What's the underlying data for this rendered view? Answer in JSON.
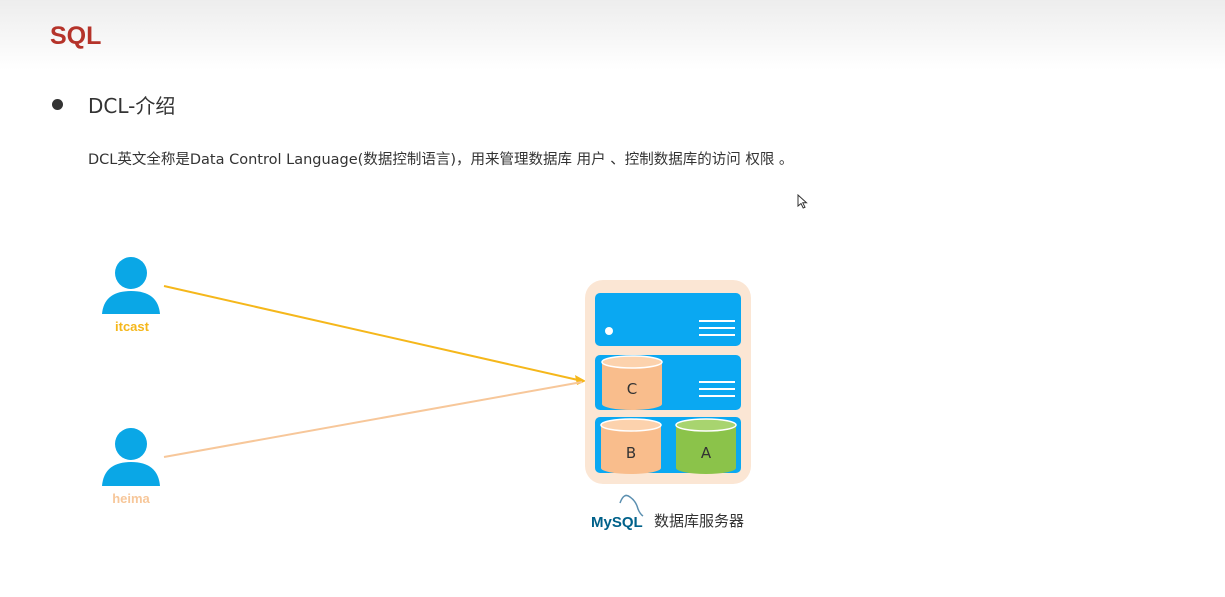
{
  "header": {
    "title": "SQL"
  },
  "content": {
    "bullet_heading": "DCL-介绍",
    "description": "DCL英文全称是Data Control Language(数据控制语言)，用来管理数据库 用户 、控制数据库的访问 权限 。"
  },
  "diagram": {
    "users": [
      {
        "name": "itcast",
        "color": "#f5b71b"
      },
      {
        "name": "heima",
        "color": "#f7c79a"
      }
    ],
    "server": {
      "databases": [
        "C",
        "B",
        "A"
      ],
      "caption": "数据库服务器",
      "logo_text": "MySQL"
    },
    "colors": {
      "user_icon": "#0aa7e6",
      "rack_background": "#fbe6d4",
      "rack_unit": "#0aa8f2",
      "cylinder_orange": "#f9bd8c",
      "cylinder_green": "#8bc34a",
      "arrow_itcast": "#f5b71b",
      "arrow_heima": "#f7c79a"
    }
  }
}
